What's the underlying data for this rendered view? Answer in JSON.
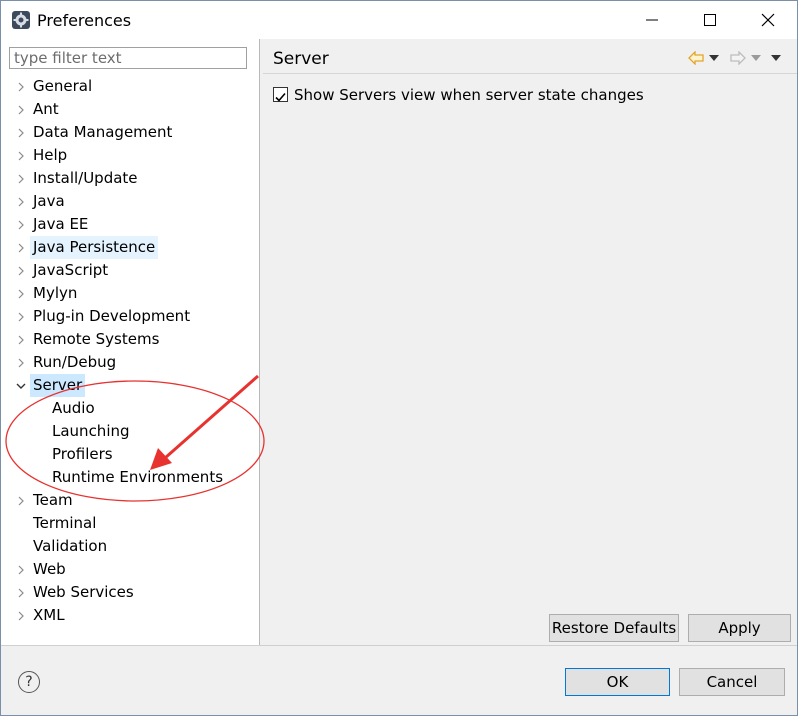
{
  "window": {
    "title": "Preferences",
    "icon": "preferences-gear-icon"
  },
  "filter": {
    "placeholder": "type filter text",
    "value": ""
  },
  "tree": {
    "items": [
      {
        "label": "General",
        "expandable": true
      },
      {
        "label": "Ant",
        "expandable": true
      },
      {
        "label": "Data Management",
        "expandable": true
      },
      {
        "label": "Help",
        "expandable": true
      },
      {
        "label": "Install/Update",
        "expandable": true
      },
      {
        "label": "Java",
        "expandable": true
      },
      {
        "label": "Java EE",
        "expandable": true
      },
      {
        "label": "Java Persistence",
        "expandable": true,
        "state": "hover"
      },
      {
        "label": "JavaScript",
        "expandable": true
      },
      {
        "label": "Mylyn",
        "expandable": true
      },
      {
        "label": "Plug-in Development",
        "expandable": true
      },
      {
        "label": "Remote Systems",
        "expandable": true
      },
      {
        "label": "Run/Debug",
        "expandable": true
      },
      {
        "label": "Server",
        "expandable": true,
        "expanded": true,
        "state": "selected"
      },
      {
        "label": "Audio",
        "child": true
      },
      {
        "label": "Launching",
        "child": true
      },
      {
        "label": "Profilers",
        "child": true
      },
      {
        "label": "Runtime Environments",
        "child": true
      },
      {
        "label": "Team",
        "expandable": true
      },
      {
        "label": "Terminal",
        "expandable": false
      },
      {
        "label": "Validation",
        "expandable": false
      },
      {
        "label": "Web",
        "expandable": true
      },
      {
        "label": "Web Services",
        "expandable": true
      },
      {
        "label": "XML",
        "expandable": true
      }
    ]
  },
  "page": {
    "title": "Server",
    "checkbox": {
      "label": "Show Servers view when server state changes",
      "checked": true
    },
    "restore_defaults_label": "Restore Defaults",
    "apply_label": "Apply"
  },
  "footer": {
    "ok_label": "OK",
    "cancel_label": "Cancel",
    "help_icon": "help-icon"
  },
  "colors": {
    "selection": "#cce8ff",
    "hover": "#e5f3ff",
    "annotation_red": "#e8322f",
    "back_arrow": "#e3a52e"
  }
}
